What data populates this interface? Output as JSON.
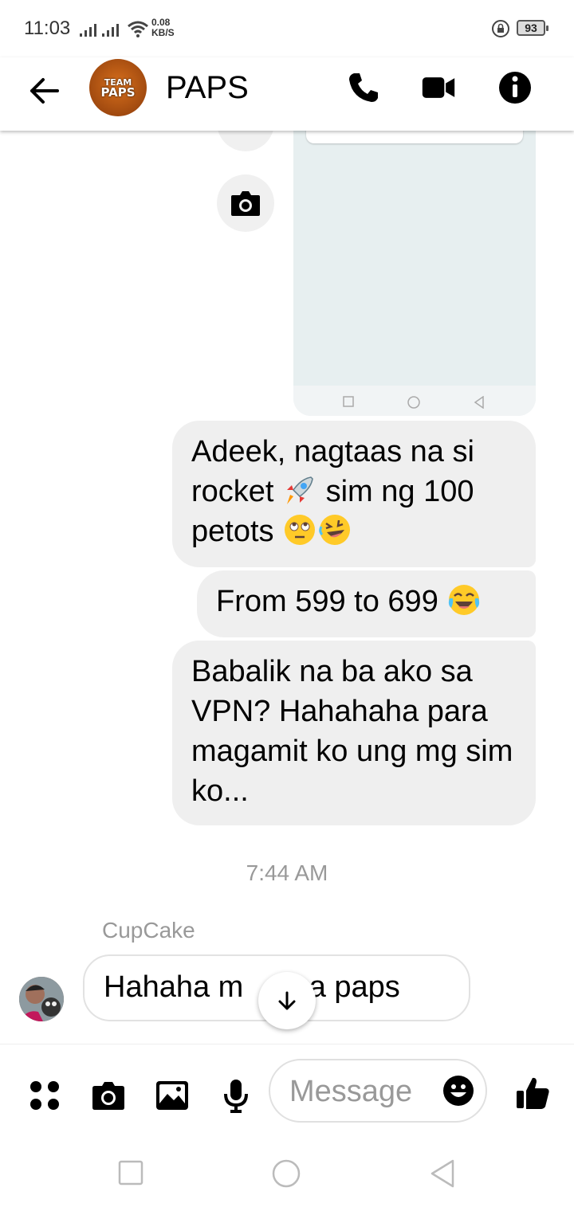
{
  "status_bar": {
    "time": "11:03",
    "net_speed_value": "0.08",
    "net_speed_unit": "KB/S",
    "battery": "93"
  },
  "header": {
    "title": "PAPS",
    "avatar_text_top": "TEAM",
    "avatar_text_bottom": "PAPS"
  },
  "messages": {
    "sent": [
      {
        "text_before": "Adeek, nagtaas na si rocket ",
        "text_middle": " sim ng 100 petots ",
        "emojis": [
          "rocket",
          "face-with-rolling-eyes",
          "rolling-on-floor-laughing"
        ]
      },
      {
        "text_before": "From 599 to 699 ",
        "emojis": [
          "face-with-tears-of-joy"
        ]
      },
      {
        "text_before": "Babalik na ba ako sa VPN? Hahahaha para magamit ko ung mg sim ko..."
      }
    ],
    "timestamp": "7:44 AM",
    "received": {
      "sender": "CupCake",
      "text": "Hahaha m    l na paps"
    }
  },
  "composer": {
    "placeholder": "Message"
  },
  "colors": {
    "bubble_sent_bg": "#efefef",
    "timestamp": "#999999",
    "preview_bg": "#e7eff0"
  }
}
